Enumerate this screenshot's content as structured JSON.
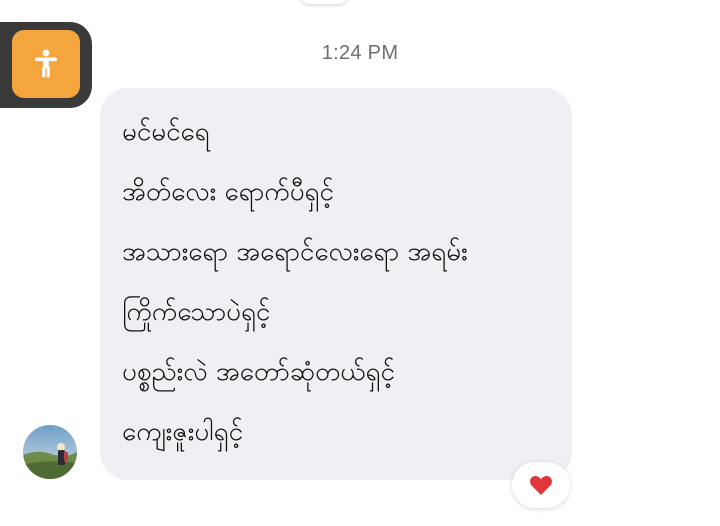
{
  "conversation": {
    "timestamp": "1:24 PM",
    "message": {
      "lines": [
        "မင်မင်ရေ",
        " အိတ်လေး ရောက်ပီရှင့်",
        "အသားရော အရောင်လေးရော အရမ်း",
        "ကြိုက်သောပဲရှင့်",
        "ပစ္စည်းလဲ အတော်ဆုံတယ်ရှင့်",
        "ကျေးဇူးပါရှင့်"
      ],
      "reaction": "heart-icon"
    },
    "sender_avatar": "avatar"
  },
  "accessibility_button": {
    "icon": "accessibility-icon"
  },
  "colors": {
    "bubble_bg": "#efeff4",
    "timestamp_text": "#6f6f73",
    "accessibility_button": "#f5a53d",
    "accessibility_tab": "#3a3a3a",
    "heart": "#e0353a"
  }
}
